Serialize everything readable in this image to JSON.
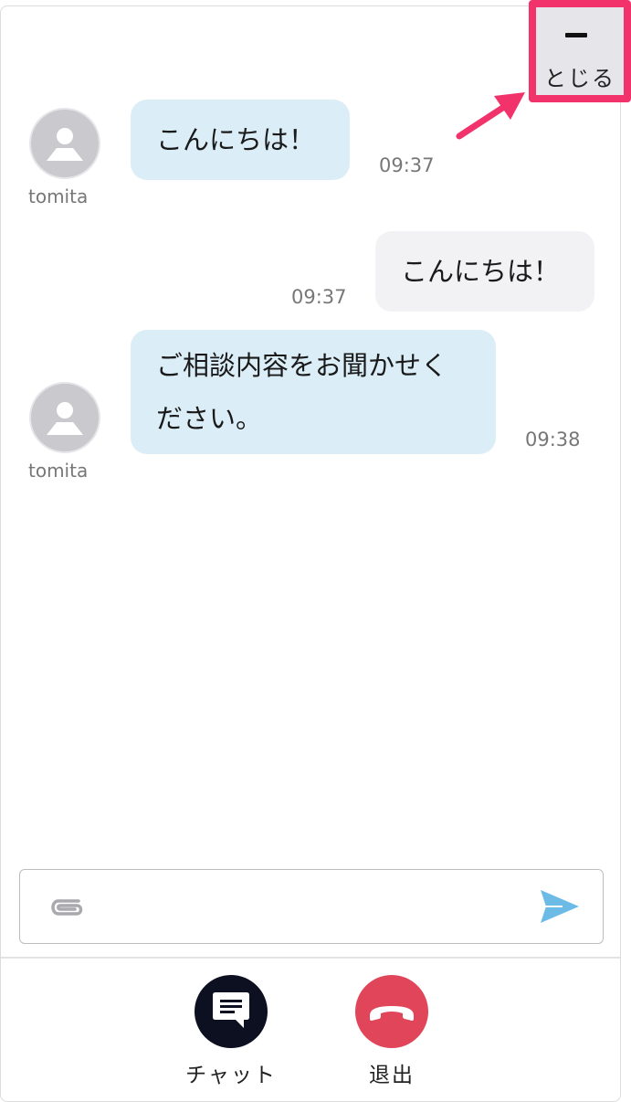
{
  "header": {
    "close_icon": "minimize-bar-icon",
    "close_label": "とじる"
  },
  "messages": [
    {
      "direction": "incoming",
      "sender": "tomita",
      "avatar_icon": "user-avatar-icon",
      "lines": [
        "こんにちは！"
      ],
      "time": "09:37"
    },
    {
      "direction": "outgoing",
      "lines": [
        "こんにちは！"
      ],
      "time": "09:37"
    },
    {
      "direction": "incoming",
      "sender": "tomita",
      "avatar_icon": "user-avatar-icon",
      "lines": [
        "ご相談内容をお聞かせく",
        "ださい。"
      ],
      "time": "09:38"
    }
  ],
  "composer": {
    "value": "",
    "placeholder": "",
    "attach_icon": "paperclip-icon",
    "send_icon": "send-icon"
  },
  "actions": {
    "chat": {
      "label": "チャット",
      "icon": "chat-icon",
      "color": "#0d1021"
    },
    "leave": {
      "label": "退出",
      "icon": "hangup-icon",
      "color": "#e0455a"
    }
  },
  "colors": {
    "incoming_bubble": "#dbeef8",
    "outgoing_bubble": "#f2f2f4",
    "highlight": "#f2336b",
    "send": "#6cbbe6"
  }
}
